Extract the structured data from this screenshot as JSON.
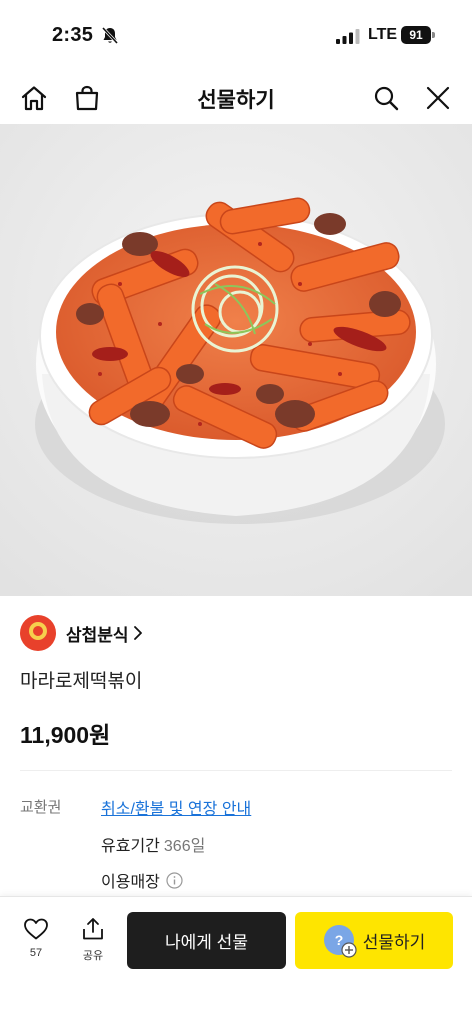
{
  "status_bar": {
    "time": "2:35",
    "network": "LTE",
    "battery": "91"
  },
  "header": {
    "title": "선물하기",
    "icons": [
      "home-icon",
      "shopping-bag-icon",
      "search-icon",
      "close-icon"
    ]
  },
  "hero": {
    "alt": "마라로제떡볶이 product photo"
  },
  "store": {
    "name": "삼첩분식",
    "logo_text": "삼첩분식"
  },
  "product": {
    "name": "마라로제떡볶이",
    "price": "11,900원"
  },
  "info": {
    "label": "교환권",
    "link": "취소/환불 및 연장 안내",
    "validity_label": "유효기간",
    "validity_value": "366일",
    "stores_label": "이용매장"
  },
  "bottom_bar": {
    "like_count": "57",
    "share_label": "공유",
    "self_gift_label": "나에게 선물",
    "gift_label": "선물하기"
  },
  "colors": {
    "accent_yellow": "#fee500",
    "dark_button": "#1e1e1e",
    "link_blue": "#1a73d9",
    "logo_red": "#e8412b"
  }
}
